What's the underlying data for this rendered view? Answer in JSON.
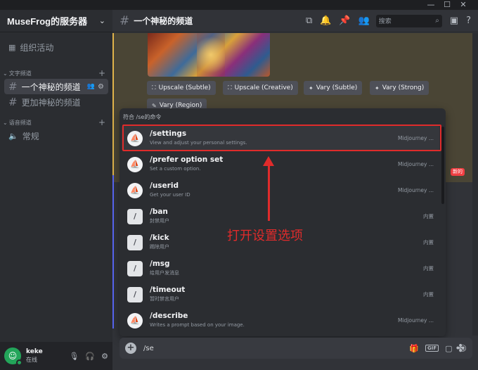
{
  "window": {
    "minimize": "—",
    "maximize": "☐",
    "close": "✕"
  },
  "server": {
    "name": "MuseFrog的服务器"
  },
  "sidebar": {
    "events_label": "组织活动",
    "text_category": "文字频道",
    "text_channels": [
      {
        "name": "一个神秘的频道",
        "active": true
      },
      {
        "name": "更加神秘的频道",
        "active": false
      }
    ],
    "voice_category": "语音频道",
    "voice_channels": [
      {
        "name": "常规"
      }
    ]
  },
  "user": {
    "name": "keke",
    "status": "在线"
  },
  "header": {
    "channel": "一个神秘的频道",
    "search_placeholder": "搜索"
  },
  "message": {
    "buttons_row1": [
      "Upscale (Subtle)",
      "Upscale (Creative)",
      "Vary (Subtle)",
      "Vary (Strong)"
    ],
    "buttons_row2": [
      "Vary (Region)"
    ],
    "new_badge": "新的"
  },
  "popup": {
    "header": "符合 /se的命令",
    "commands": [
      {
        "name": "/settings",
        "desc": "View and adjust your personal settings.",
        "source": "Midjourney ...",
        "icon": "bot"
      },
      {
        "name": "/prefer option set",
        "desc": "Set a custom option.",
        "source": "Midjourney ...",
        "icon": "bot"
      },
      {
        "name": "/userid",
        "desc": "Get your user ID",
        "source": "Midjourney ...",
        "icon": "bot"
      },
      {
        "name": "/ban",
        "desc": "封禁用户",
        "source": "内置",
        "icon": "builtin"
      },
      {
        "name": "/kick",
        "desc": "踢除用户",
        "source": "内置",
        "icon": "builtin"
      },
      {
        "name": "/msg",
        "desc": "给用户发消息",
        "source": "内置",
        "icon": "builtin"
      },
      {
        "name": "/timeout",
        "desc": "暂时禁言用户",
        "source": "内置",
        "icon": "builtin"
      },
      {
        "name": "/describe",
        "desc": "Writes a prompt based on your image.",
        "source": "Midjourney ...",
        "icon": "bot"
      }
    ]
  },
  "annotation": {
    "text": "打开设置选项",
    "color": "#e02b2b"
  },
  "input": {
    "value": "/se"
  },
  "colors": {
    "accent": "#5865f2",
    "highlight": "#e02b2b",
    "online": "#23a55a"
  }
}
